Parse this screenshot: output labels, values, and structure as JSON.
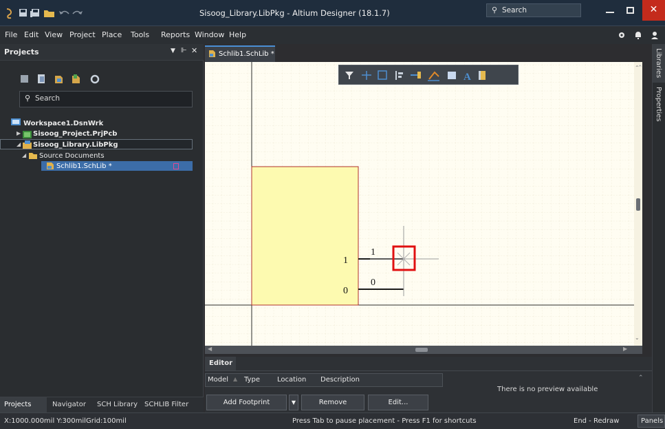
{
  "window": {
    "title": "Sisoog_Library.LibPkg - Altium Designer (18.1.7)",
    "search_label": "Search"
  },
  "menu": [
    "File",
    "Edit",
    "View",
    "Project",
    "Place",
    "Tools",
    "Reports",
    "Window",
    "Help"
  ],
  "projects_panel": {
    "title": "Projects",
    "search_placeholder": "Search",
    "tree": [
      {
        "label": "Workspace1.DsnWrk"
      },
      {
        "label": "Sisoog_Project.PrjPcb"
      },
      {
        "label": "Sisoog_Library.LibPkg"
      },
      {
        "label": "Source Documents"
      },
      {
        "label": "Schlib1.SchLib *"
      }
    ],
    "bottom_tabs": [
      "Projects",
      "Navigator",
      "SCH Library",
      "SCHLIB Filter"
    ]
  },
  "document_tab": {
    "label": "Schlib1.SchLib *"
  },
  "schematic": {
    "body_color": "#fdfab0",
    "pins": [
      {
        "designator": "1",
        "name": "1"
      },
      {
        "designator": "0",
        "name": "0"
      }
    ]
  },
  "right_panels": [
    "Libraries",
    "Properties"
  ],
  "editor": {
    "title": "Editor",
    "columns": [
      "Model",
      "Type",
      "Location",
      "Description"
    ],
    "preview_text": "There is no preview available",
    "buttons": {
      "add_footprint": "Add Footprint",
      "remove": "Remove",
      "edit": "Edit..."
    }
  },
  "status": {
    "coords": "X:1000.000mil Y:300mil",
    "grid": "Grid:100mil",
    "hint": "Press Tab to pause placement - Press F1 for shortcuts",
    "redraw": "End - Redraw",
    "panels": "Panels"
  },
  "colors": {
    "accent": "#4a8fd6",
    "close": "#c42b1c",
    "selection": "#3c6da8",
    "cursor_box": "#e01010"
  }
}
